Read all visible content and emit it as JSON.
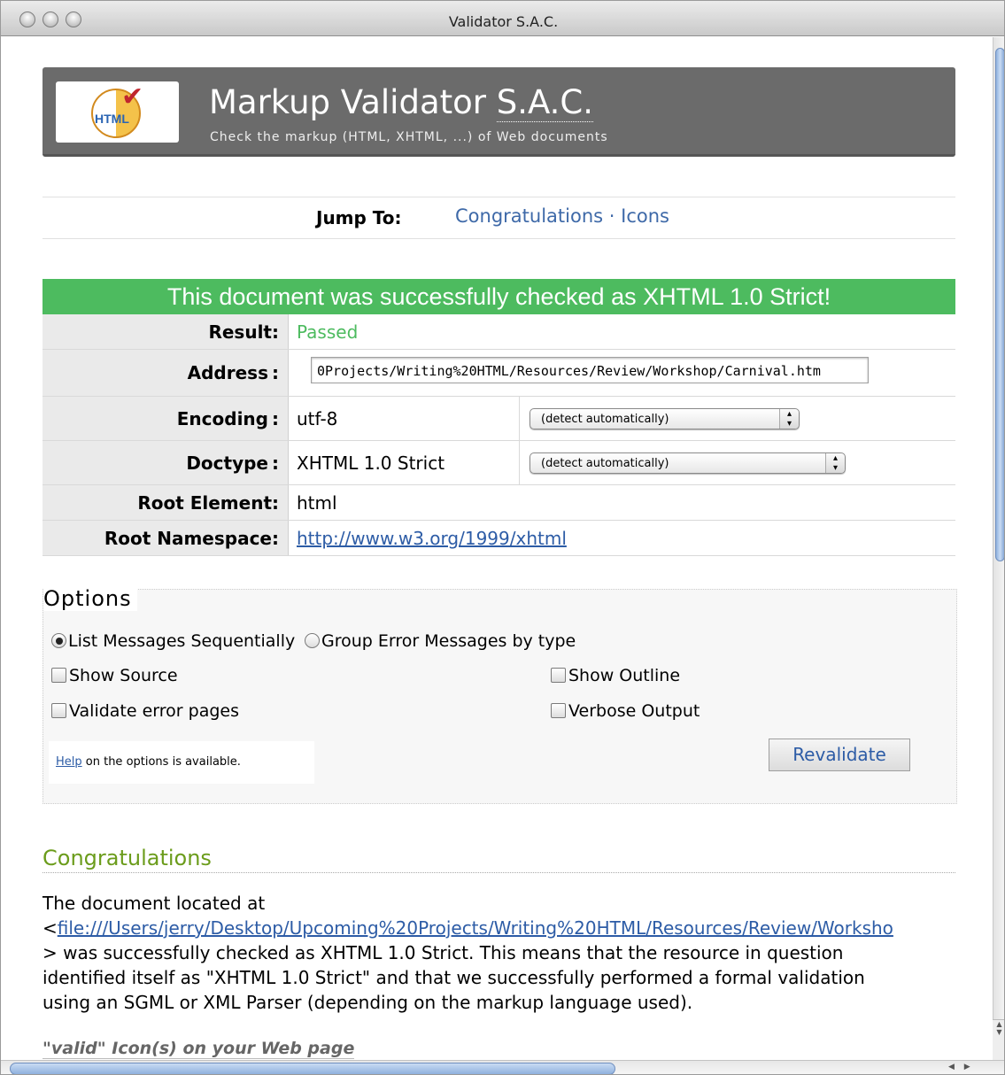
{
  "window": {
    "title": "Validator S.A.C."
  },
  "banner": {
    "logo_text": "HTML",
    "title_main": "Markup Validator",
    "title_abbr": "S.A.C.",
    "subtitle": "Check the markup (HTML, XHTML, ...) of Web documents"
  },
  "jump": {
    "label": "Jump To:",
    "link_congratulations": "Congratulations",
    "separator": "·",
    "link_icons": "Icons"
  },
  "result_header": "This document was successfully checked as XHTML 1.0 Strict!",
  "results": {
    "result_label": "Result:",
    "result_value": "Passed",
    "address_label": "Address",
    "address_colon": ":",
    "address_value": "0Projects/Writing%20HTML/Resources/Review/Workshop/Carnival.htm",
    "encoding_label": "Encoding",
    "encoding_colon": ":",
    "encoding_value": "utf-8",
    "encoding_select": "(detect automatically)",
    "doctype_label": "Doctype",
    "doctype_colon": ":",
    "doctype_value": "XHTML 1.0 Strict",
    "doctype_select": "(detect automatically)",
    "root_element_label": "Root Element:",
    "root_element_value": "html",
    "root_namespace_label": "Root Namespace:",
    "root_namespace_value": "http://www.w3.org/1999/xhtml"
  },
  "options": {
    "title": "Options",
    "radio_sequential": "List Messages Sequentially",
    "radio_group": "Group Error Messages by type",
    "show_source": "Show Source",
    "show_outline": "Show Outline",
    "validate_error_pages": "Validate error pages",
    "verbose_output": "Verbose Output",
    "help_link": "Help",
    "help_text": " on the options is available.",
    "revalidate": "Revalidate"
  },
  "congratulations": {
    "title": "Congratulations",
    "line1": "The document located at",
    "lt": "<",
    "file_link": "file:///Users/jerry/Desktop/Upcoming%20Projects/Writing%20HTML/Resources/Review/Worksho",
    "line3": "> was successfully checked as XHTML 1.0 Strict. This means that the resource in question",
    "line4": "identified itself as \"XHTML 1.0 Strict\" and that we successfully performed a formal validation",
    "line5": "using an SGML or XML Parser (depending on the markup language used)."
  },
  "valid_icons_title": "\"valid\" Icon(s) on your Web page"
}
